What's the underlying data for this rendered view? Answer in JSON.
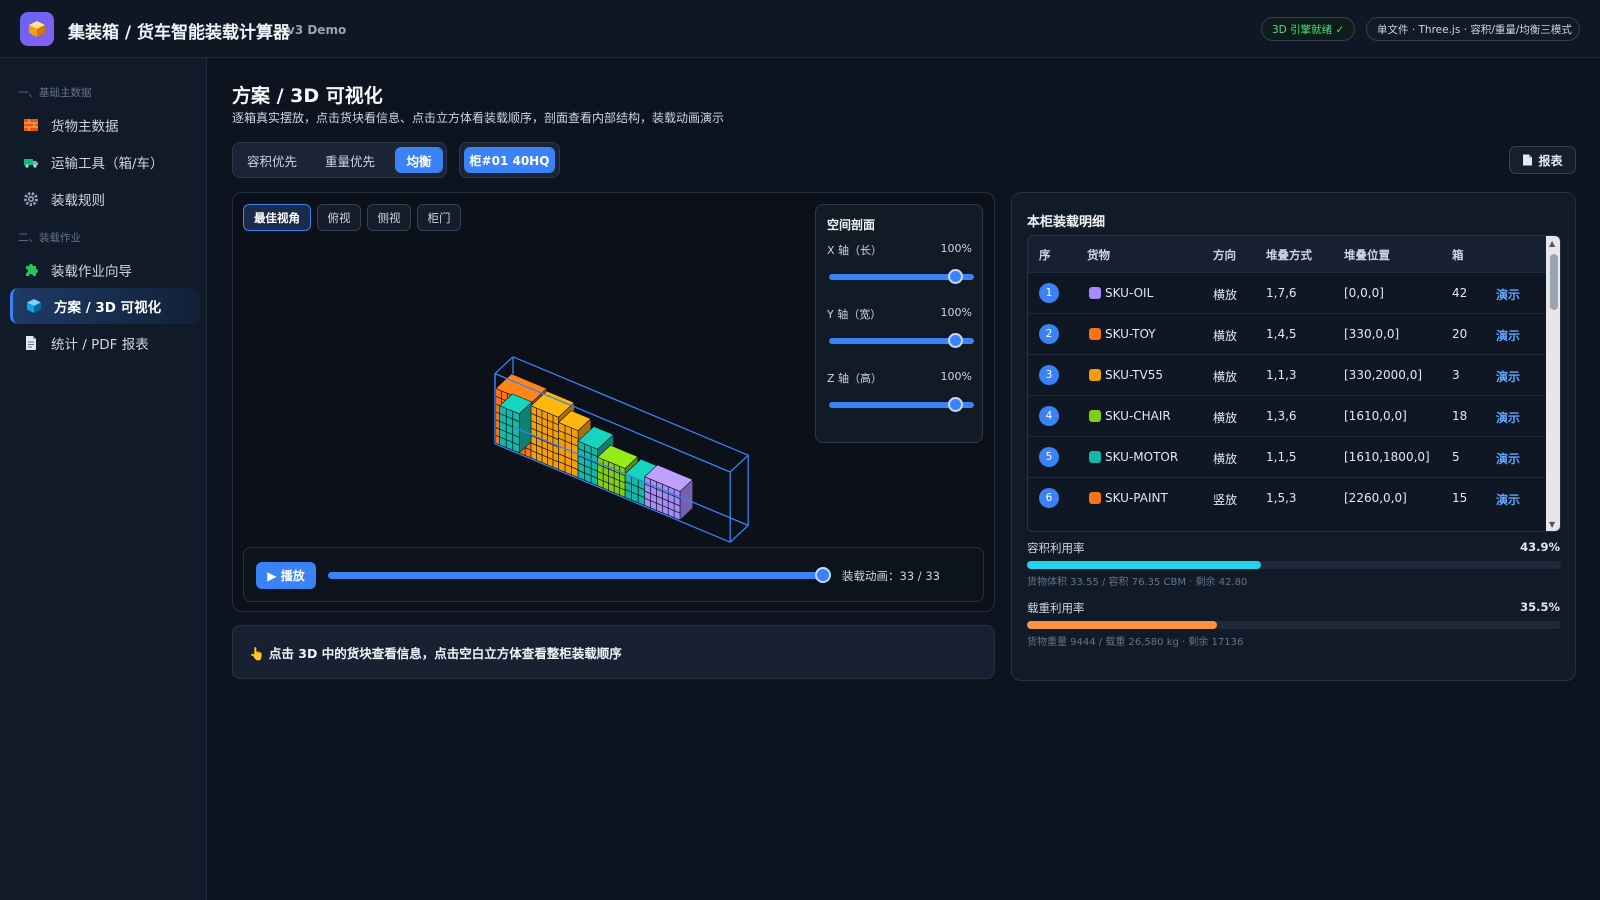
{
  "header": {
    "app_title": "集装箱 / 货车智能装载计算器",
    "version": "v3 Demo",
    "engine_status": "3D 引擎就绪 ✓",
    "info": "单文件 · Three.js · 容积/重量/均衡三模式"
  },
  "sidebar": {
    "section1": "一、基础主数据",
    "section2": "二、装载作业",
    "items": [
      {
        "label": "货物主数据"
      },
      {
        "label": "运输工具（箱/车）"
      },
      {
        "label": "装载规则"
      },
      {
        "label": "装载作业向导"
      },
      {
        "label": "方案 / 3D 可视化"
      },
      {
        "label": "统计 / PDF 报表"
      }
    ]
  },
  "main": {
    "title": "方案 / 3D 可视化",
    "subtitle": "逐箱真实摆放，点击货块看信息、点击立方体看装载顺序，剖面查看内部结构，装载动画演示",
    "modes": [
      "容积优先",
      "重量优先",
      "均衡"
    ],
    "container": "柜#01 40HQ",
    "report_label": "报表"
  },
  "viz": {
    "views": [
      "最佳视角",
      "俯视",
      "侧视",
      "柜门"
    ],
    "section_title": "空间剖面",
    "axes": [
      {
        "label": "X 轴（长）",
        "value": "100%",
        "level": 1.0
      },
      {
        "label": "Y 轴（宽）",
        "value": "100%",
        "level": 1.0
      },
      {
        "label": "Z 轴（高）",
        "value": "100%",
        "level": 1.0
      }
    ],
    "play_label": "▶ 播放",
    "anim_label": "装载动画：33 / 33",
    "anim_progress": 1.0,
    "hint": "👆 点击 3D 中的货块查看信息，点击空白立方体查看整柜装载顺序"
  },
  "detail": {
    "title": "本柜装载明细",
    "columns": [
      "序",
      "货物",
      "方向",
      "堆叠方式",
      "堆叠位置",
      "箱"
    ],
    "demo_label": "演示",
    "rows": [
      {
        "idx": "1",
        "sku": "SKU-OIL",
        "color": "#a78bfa",
        "dir": "横放",
        "stack": "1,7,6",
        "pos": "[0,0,0]",
        "qty": "42"
      },
      {
        "idx": "2",
        "sku": "SKU-TOY",
        "color": "#f97316",
        "dir": "横放",
        "stack": "1,4,5",
        "pos": "[330,0,0]",
        "qty": "20"
      },
      {
        "idx": "3",
        "sku": "SKU-TV55",
        "color": "#f59e0b",
        "dir": "横放",
        "stack": "1,1,3",
        "pos": "[330,2000,0]",
        "qty": "3"
      },
      {
        "idx": "4",
        "sku": "SKU-CHAIR",
        "color": "#84cc16",
        "dir": "横放",
        "stack": "1,3,6",
        "pos": "[1610,0,0]",
        "qty": "18"
      },
      {
        "idx": "5",
        "sku": "SKU-MOTOR",
        "color": "#14b8a6",
        "dir": "横放",
        "stack": "1,1,5",
        "pos": "[1610,1800,0]",
        "qty": "5"
      },
      {
        "idx": "6",
        "sku": "SKU-PAINT",
        "color": "#f97316",
        "dir": "竖放",
        "stack": "1,5,3",
        "pos": "[2260,0,0]",
        "qty": "15"
      }
    ],
    "volume": {
      "label": "容积利用率",
      "pct": "43.9%",
      "ratio": 0.439,
      "color": "#22d3ee",
      "sub": "货物体积 33.55 / 容积 76.35 CBM · 剩余 42.80"
    },
    "weight": {
      "label": "载重利用率",
      "pct": "35.5%",
      "ratio": 0.355,
      "color": "#fb923c",
      "sub": "货物重量 9444 / 载重 26,580 kg · 剩余 17136"
    }
  }
}
